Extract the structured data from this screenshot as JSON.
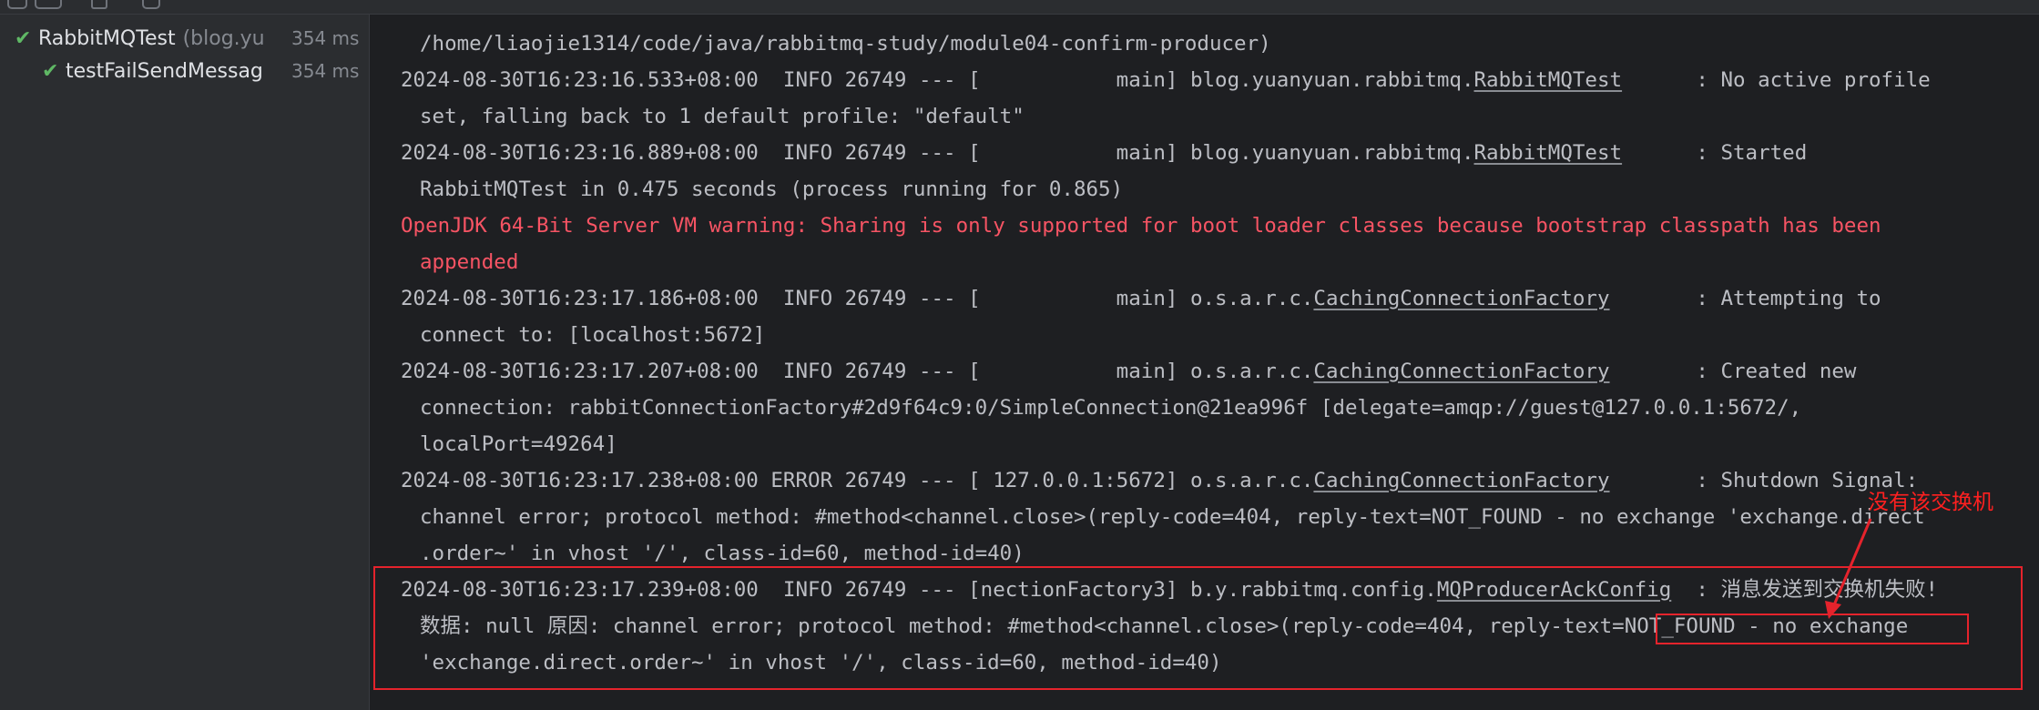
{
  "colors": {
    "background": "#1e1f22",
    "panel": "#2b2d30",
    "text": "#bcbec4",
    "error_text": "#f75464",
    "pass_green": "#5fb865",
    "annotation_red": "#e5232c"
  },
  "toolbar": {
    "icons": [
      "run-icon",
      "history-icon",
      "rerun-icon",
      "clock-icon"
    ]
  },
  "tree": {
    "items": [
      {
        "name": "RabbitMQTest",
        "hint": "(blog.yu",
        "duration": "354 ms",
        "status_icon": "check-icon"
      },
      {
        "name": "testFailSendMessag",
        "hint": "",
        "duration": "354 ms",
        "status_icon": "check-icon"
      }
    ]
  },
  "console": {
    "lines": {
      "l0": "/home/liaojie1314/code/java/rabbitmq-study/module04-confirm-producer)",
      "l1a": "2024-08-30T16:23:16.533+08:00  INFO 26749 --- [           main] blog.yuanyuan.rabbitmq.",
      "l1link": "RabbitMQTest",
      "l1b": "      : No active profile",
      "l2": "set, falling back to 1 default profile: \"default\"",
      "l3a": "2024-08-30T16:23:16.889+08:00  INFO 26749 --- [           main] blog.yuanyuan.rabbitmq.",
      "l3link": "RabbitMQTest",
      "l3b": "      : Started",
      "l4": "RabbitMQTest in 0.475 seconds (process running for 0.865)",
      "l5": "OpenJDK 64-Bit Server VM warning: Sharing is only supported for boot loader classes because bootstrap classpath has been",
      "l6": "appended",
      "l7a": "2024-08-30T16:23:17.186+08:00  INFO 26749 --- [           main] o.s.a.r.c.",
      "l7link": "CachingConnectionFactory",
      "l7b": "       : Attempting to",
      "l8": "connect to: [localhost:5672]",
      "l9a": "2024-08-30T16:23:17.207+08:00  INFO 26749 --- [           main] o.s.a.r.c.",
      "l9link": "CachingConnectionFactory",
      "l9b": "       : Created new",
      "l10": "connection: rabbitConnectionFactory#2d9f64c9:0/SimpleConnection@21ea996f [delegate=amqp://guest@127.0.0.1:5672/,",
      "l11": "localPort=49264]",
      "l12a": "2024-08-30T16:23:17.238+08:00 ERROR 26749 --- [ 127.0.0.1:5672] o.s.a.r.c.",
      "l12link": "CachingConnectionFactory",
      "l12b": "       : Shutdown Signal:",
      "l13": "channel error; protocol method: #method<channel.close>(reply-code=404, reply-text=NOT_FOUND - no exchange 'exchange.direct",
      "l14": ".order~' in vhost '/', class-id=60, method-id=40)",
      "l15a": "2024-08-30T16:23:17.239+08:00  INFO 26749 --- [nectionFactory3] b.y.rabbitmq.config.",
      "l15link": "MQProducerAckConfig",
      "l15b": "  : 消息发送到交换机失败!",
      "l16": "数据: null 原因: channel error; protocol method: #method<channel.close>(reply-code=404, reply-text=NOT_FOUND - no exchange",
      "l17": "'exchange.direct.order~' in vhost '/', class-id=60, method-id=40)"
    }
  },
  "annotation": {
    "label": "没有该交换机"
  }
}
